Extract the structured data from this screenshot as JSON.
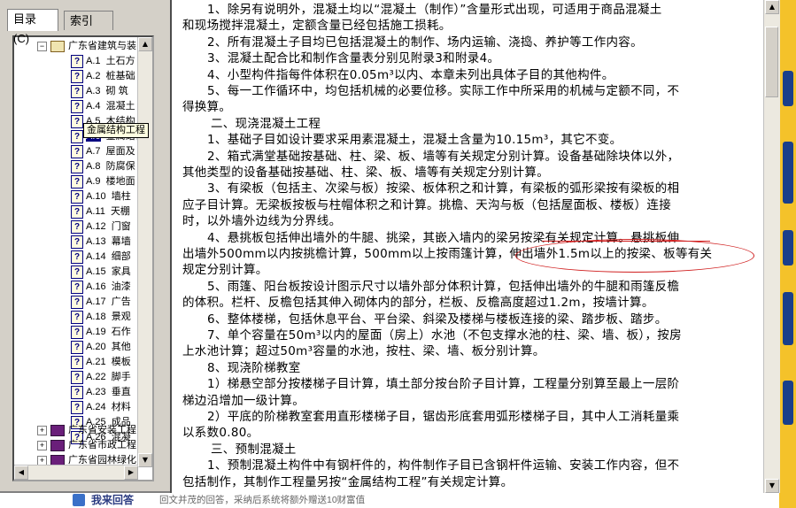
{
  "tabs": [
    {
      "label": "目录(C)"
    },
    {
      "label": "索引(N)"
    }
  ],
  "tree": {
    "root_label": "广东省建筑与装",
    "items": [
      {
        "code": "A.1",
        "label": "土石方"
      },
      {
        "code": "A.2",
        "label": "桩基础"
      },
      {
        "code": "A.3",
        "label": "砌  筑"
      },
      {
        "code": "A.4",
        "label": "混凝土"
      },
      {
        "code": "A.5",
        "label": "木结构"
      },
      {
        "code": "A.6",
        "label": "金属结构工程"
      },
      {
        "code": "A.7",
        "label": "屋面及"
      },
      {
        "code": "A.8",
        "label": "防腐保"
      },
      {
        "code": "A.9",
        "label": "楼地面"
      },
      {
        "code": "A.10",
        "label": "墙柱"
      },
      {
        "code": "A.11",
        "label": "天棚"
      },
      {
        "code": "A.12",
        "label": "门窗"
      },
      {
        "code": "A.13",
        "label": "幕墙"
      },
      {
        "code": "A.14",
        "label": "细部"
      },
      {
        "code": "A.15",
        "label": "家具"
      },
      {
        "code": "A.16",
        "label": "油漆"
      },
      {
        "code": "A.17",
        "label": "广告"
      },
      {
        "code": "A.18",
        "label": "景观"
      },
      {
        "code": "A.19",
        "label": "石作"
      },
      {
        "code": "A.20",
        "label": "其他"
      },
      {
        "code": "A.21",
        "label": "模板"
      },
      {
        "code": "A.22",
        "label": "脚手"
      },
      {
        "code": "A.23",
        "label": "垂直"
      },
      {
        "code": "A.24",
        "label": "材料"
      },
      {
        "code": "A.25",
        "label": "成品"
      },
      {
        "code": "A.26",
        "label": "混凝"
      }
    ],
    "other_books": [
      {
        "label": "广东省安装工程"
      },
      {
        "label": "广东省市政工程"
      },
      {
        "label": "广东省园林绿化"
      }
    ],
    "tooltip": "金属结构工程"
  },
  "content": {
    "lines": [
      "1、除另有说明外，混凝土均以“混凝土（制作）”含量形式出现，可适用于商品混凝土",
      "和现场搅拌混凝土，定额含量已经包括施工损耗。",
      "2、所有混凝土子目均已包括混凝土的制作、场内运输、浇捣、养护等工作内容。",
      "3、混凝土配合比和制作含量表分别见附录3和附录4。",
      "4、小型构件指每件体积在0.05m³以内、本章未列出具体子目的其他构件。",
      "5、每一工作循环中，均包括机械的必要位移。实际工作中所采用的机械与定额不同，不",
      "得换算。",
      "二、现浇混凝土工程",
      "1、基础子目如设计要求采用素混凝土，混凝土含量为10.15m³，其它不变。",
      "2、箱式满堂基础按基础、柱、梁、板、墙等有关规定分别计算。设备基础除块体以外，",
      "其他类型的设备基础按基础、柱、梁、板、墙等有关规定分别计算。",
      "3、有梁板（包括主、次梁与板）按梁、板体积之和计算，有梁板的弧形梁按有梁板的相",
      "应子目计算。无梁板按板与柱帽体积之和计算。挑檐、天沟与板（包括屋面板、楼板）连接",
      "时，以外墙外边线为分界线。",
      "4、悬挑板包括伸出墙外的牛腿、挑梁，其嵌入墙内的梁另按梁有关规定计算。悬挑板伸",
      "出墙外500mm以内按挑檐计算，500mm以上按雨篷计算，伸出墙外1.5m以上的按梁、板等有关",
      "规定分别计算。",
      "5、雨篷、阳台板按设计图示尺寸以墙外部分体积计算，包括伸出墙外的牛腿和雨篷反檐",
      "的体积。栏杆、反檐包括其伸入砌体内的部分，栏板、反檐高度超过1.2m，按墙计算。",
      "6、整体楼梯，包括休息平台、平台梁、斜梁及楼梯与楼板连接的梁、踏步板、踏步。",
      "7、单个容量在50m³以内的屋面（房上）水池（不包支撑水池的柱、梁、墙、板），按房",
      "上水池计算；超过50m³容量的水池，按柱、梁、墙、板分别计算。",
      "8、现浇阶梯教室",
      "1）梯悬空部分按楼梯子目计算，填土部分按台阶子目计算，工程量分别算至最上一层阶",
      "梯边沿增加一级计算。",
      "2）平底的阶梯教室套用直形楼梯子目，锯齿形底套用弧形楼梯子目，其中人工消耗量乘",
      "以系数0.80。",
      "三、预制混凝土",
      "1、预制混凝土构件中有钢杆件的，构件制作子目已含钢杆件运输、安装工作内容，但不",
      "包括制作，其制作工程量另按“金属结构工程”有关规定计算。"
    ]
  },
  "bottom": {
    "label": "我来回答",
    "desc": "回文并茂的回答，采纳后系统将额外赠送10财富值"
  },
  "colors": {
    "window_bg": "#d4d0c8",
    "selection": "#000080",
    "annotation": "#d02020",
    "backdrop": "#f4c22a"
  }
}
